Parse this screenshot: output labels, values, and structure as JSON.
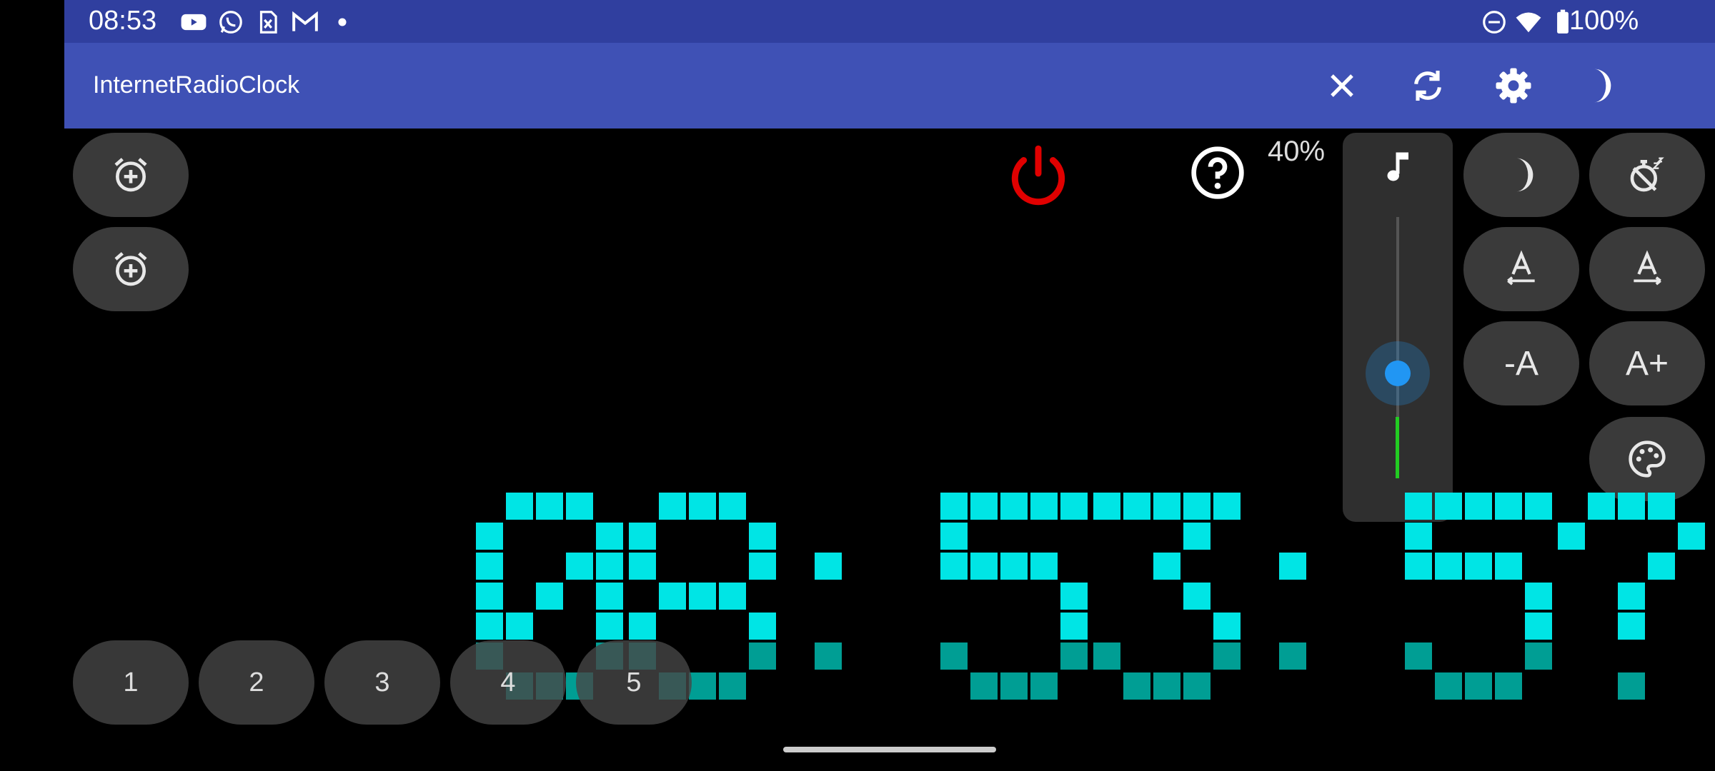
{
  "status_bar": {
    "time": "08:53",
    "battery_text": "100%",
    "left_icons": [
      "youtube-icon",
      "whatsapp-icon",
      "sim-icon",
      "gmail-icon",
      "dot-icon"
    ],
    "right_icons": [
      "do-not-disturb-icon",
      "wifi-icon",
      "battery-icon"
    ]
  },
  "app_bar": {
    "title": "InternetRadioClock",
    "actions": [
      "close-icon",
      "sync-icon",
      "gear-icon",
      "moon-icon",
      "more-vert-icon"
    ]
  },
  "volume": {
    "percent_text": "40%",
    "level": 0.4
  },
  "font_controls": {
    "decrease_label": "-A",
    "increase_label": "A+"
  },
  "station_buttons": [
    "1",
    "2",
    "3",
    "4",
    "5"
  ],
  "clock": {
    "time": "08:53:5?",
    "digit_color": "#00e5e5",
    "digit_dim_color": "#009e94"
  },
  "colors": {
    "statusbar": "#303f9f",
    "appbar": "#3f51b5",
    "power": "#e00000",
    "slider_thumb": "#2196f3",
    "level_meter": "#22cc22"
  }
}
